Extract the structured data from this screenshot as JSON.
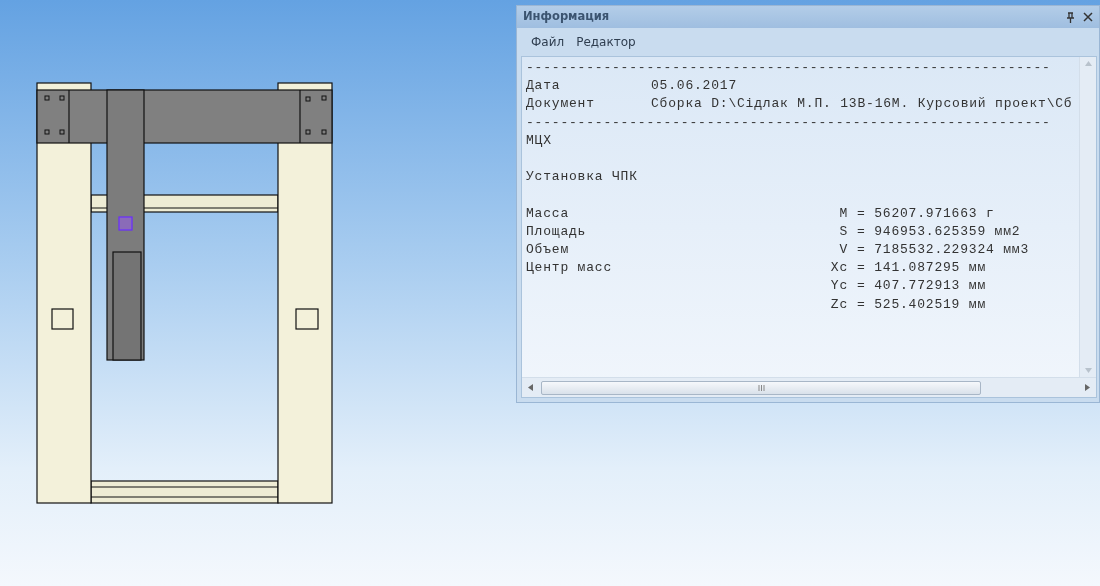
{
  "info_panel": {
    "title": "Информация",
    "menu": [
      {
        "label": "Файл"
      },
      {
        "label": "Редактор"
      }
    ],
    "report": {
      "separator": "-------------------------------------------------------------",
      "date_label": "Дата",
      "date": "05.06.2017",
      "document_label": "Документ",
      "document": "Сборка D:\\Сідлак М.П. 13В-16М. Курсовий проект\\Сб",
      "section": "МЦХ",
      "object": "Установка ЧПК",
      "properties": [
        {
          "label": "Масса",
          "symbol": "M",
          "value": "= 56207.971663 г"
        },
        {
          "label": "Площадь",
          "symbol": "S",
          "value": "= 946953.625359 мм2"
        },
        {
          "label": "Объем",
          "symbol": "V",
          "value": "= 7185532.229324 мм3"
        },
        {
          "label": "Центр масс",
          "symbol": "Xc",
          "value": "= 141.087295 мм"
        },
        {
          "symbol": "Yc",
          "value": "= 407.772913 мм"
        },
        {
          "symbol": "Zc",
          "value": "= 525.402519 мм"
        }
      ]
    }
  }
}
